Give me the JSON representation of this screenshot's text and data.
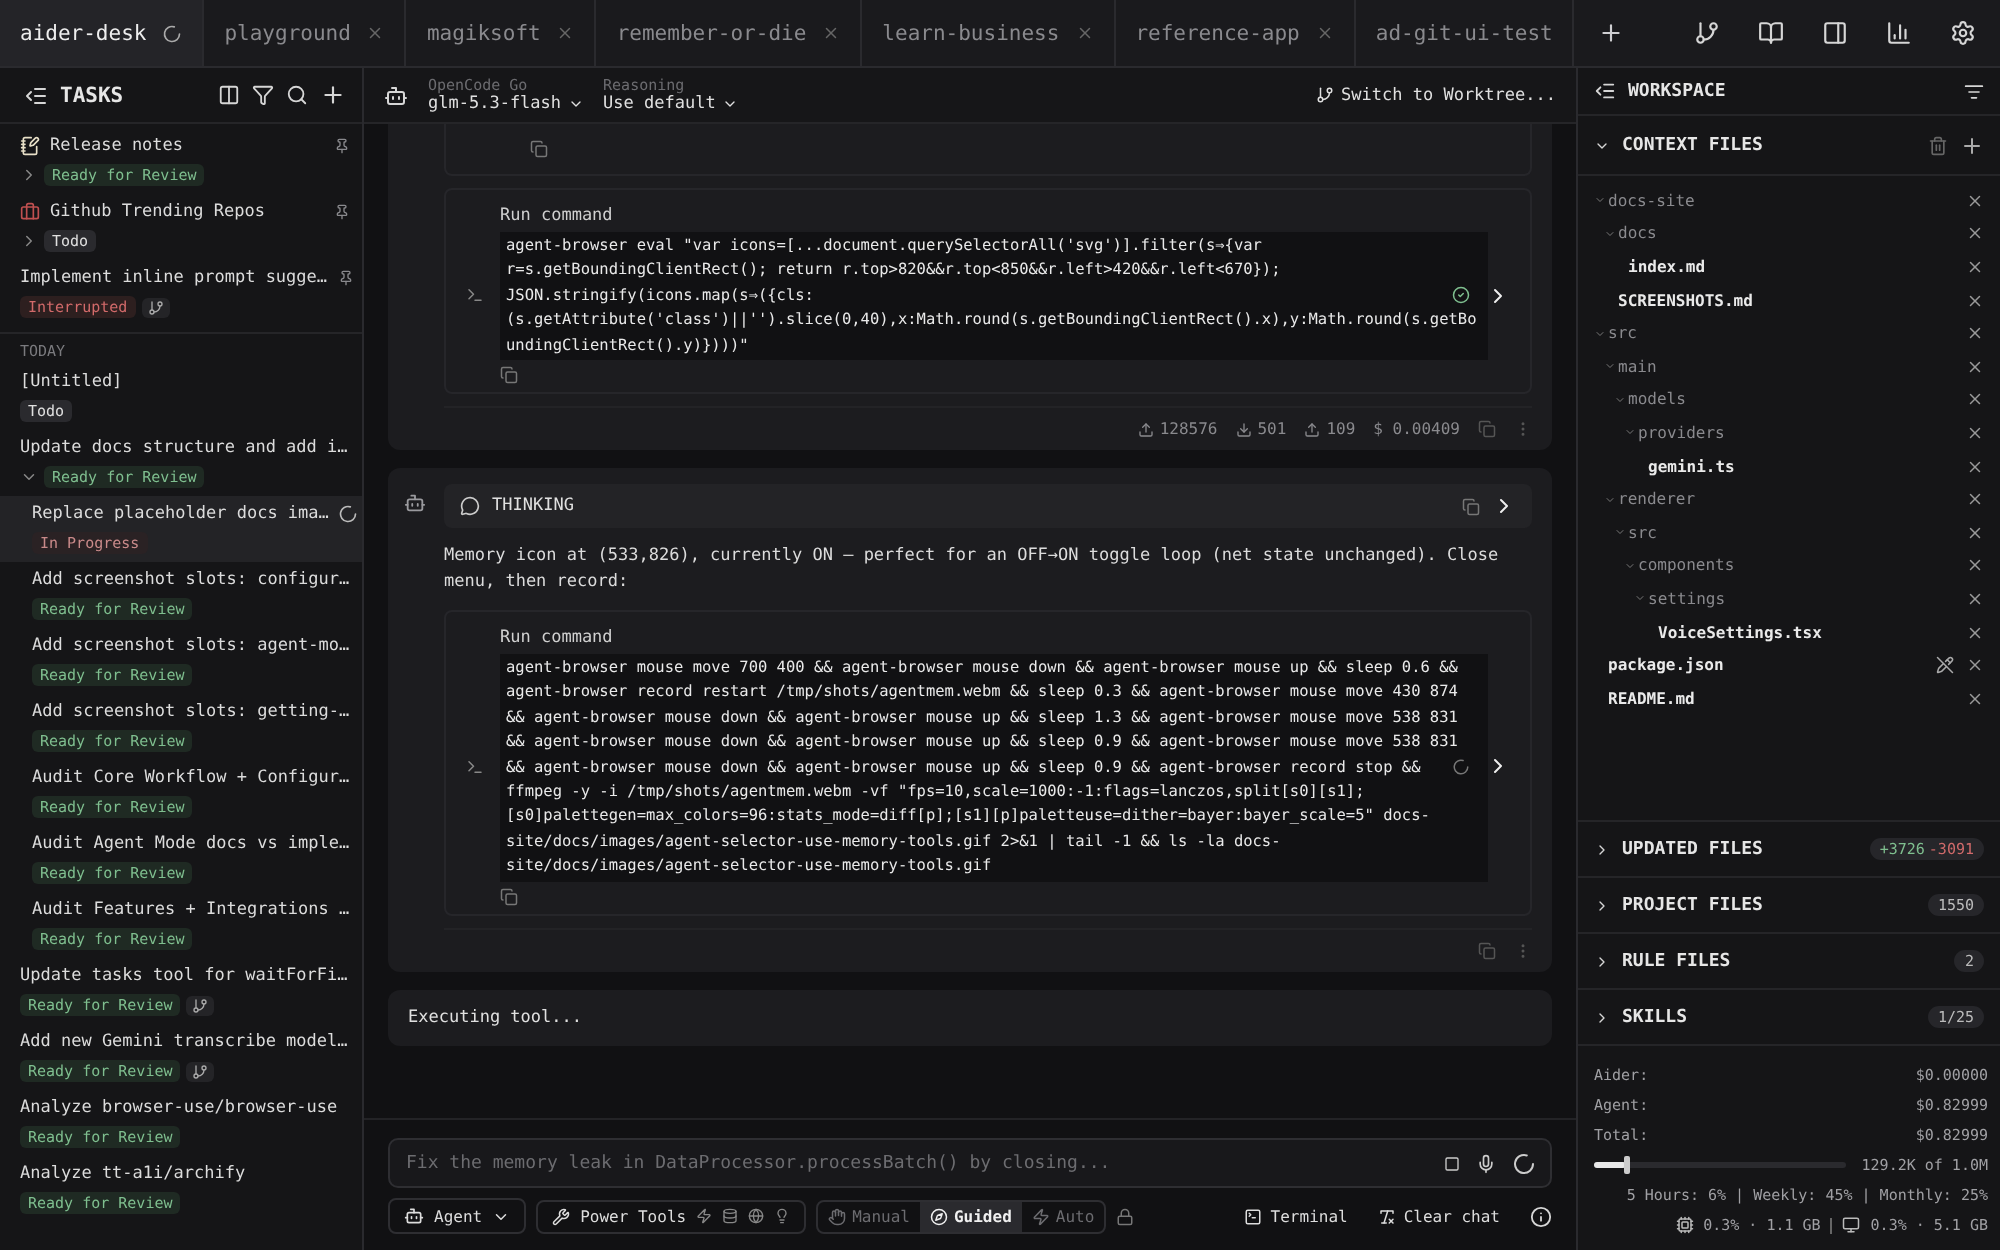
{
  "tabs": [
    {
      "label": "aider-desk",
      "selected": true,
      "loading": true,
      "closable": false
    },
    {
      "label": "playground",
      "selected": false,
      "loading": false,
      "closable": true
    },
    {
      "label": "magiksoft",
      "selected": false,
      "loading": false,
      "closable": true
    },
    {
      "label": "remember-or-die",
      "selected": false,
      "loading": false,
      "closable": true
    },
    {
      "label": "learn-business",
      "selected": false,
      "loading": false,
      "closable": true
    },
    {
      "label": "reference-app",
      "selected": false,
      "loading": false,
      "closable": true
    },
    {
      "label": "ad-git-ui-test",
      "selected": false,
      "loading": false,
      "closable": false
    }
  ],
  "tasks": {
    "title": "TASKS",
    "pinned": [
      {
        "title": "Release notes",
        "kind": "note",
        "pinned": true,
        "expanded": false,
        "status": {
          "label": "Ready for Review",
          "kind": "review"
        }
      },
      {
        "title": "Github Trending Repos",
        "kind": "briefcase",
        "pinned": true,
        "expanded": false,
        "status": {
          "label": "Todo",
          "kind": "todo"
        }
      },
      {
        "title": "Implement inline prompt sugge…",
        "pinned": true,
        "branch": true,
        "status": {
          "label": "Interrupted",
          "kind": "interrupted"
        }
      }
    ],
    "groups": [
      {
        "label": "TODAY",
        "items": [
          {
            "title": "[Untitled]",
            "status": {
              "label": "Todo",
              "kind": "todo"
            }
          },
          {
            "title": "Update docs structure and add i…",
            "expanded": true,
            "status": {
              "label": "Ready for Review",
              "kind": "review"
            },
            "children": [
              {
                "title": "Replace placeholder docs ima…",
                "selected": true,
                "loading": true,
                "status": {
                  "label": "In Progress",
                  "kind": "progress"
                }
              },
              {
                "title": "Add screenshot slots: configur…",
                "selected": false,
                "status": {
                  "label": "Ready for Review",
                  "kind": "review"
                }
              },
              {
                "title": "Add screenshot slots: agent-mo…",
                "selected": false,
                "status": {
                  "label": "Ready for Review",
                  "kind": "review"
                }
              },
              {
                "title": "Add screenshot slots: getting-…",
                "selected": false,
                "status": {
                  "label": "Ready for Review",
                  "kind": "review"
                }
              },
              {
                "title": "Audit Core Workflow + Configur…",
                "selected": false,
                "status": {
                  "label": "Ready for Review",
                  "kind": "review"
                }
              },
              {
                "title": "Audit Agent Mode docs vs imple…",
                "selected": false,
                "status": {
                  "label": "Ready for Review",
                  "kind": "review"
                }
              },
              {
                "title": "Audit Features + Integrations …",
                "selected": false,
                "status": {
                  "label": "Ready for Review",
                  "kind": "review"
                }
              }
            ]
          },
          {
            "title": "Update tasks tool for waitForFi…",
            "branch": true,
            "status": {
              "label": "Ready for Review",
              "kind": "review"
            }
          },
          {
            "title": "Add new Gemini transcribe model…",
            "branch": true,
            "status": {
              "label": "Ready for Review",
              "kind": "review"
            }
          },
          {
            "title": "Analyze browser-use/browser-use",
            "status": {
              "label": "Ready for Review",
              "kind": "review"
            }
          },
          {
            "title": "Analyze tt-a1i/archify",
            "status": {
              "label": "Ready for Review",
              "kind": "review"
            }
          }
        ]
      }
    ]
  },
  "model_bar": {
    "provider": "OpenCode Go",
    "model": "glm-5.3-flash",
    "reasoning_label": "Reasoning",
    "reasoning": "Use default",
    "worktree": "Switch to Worktree..."
  },
  "messages": [
    {
      "avatar": false,
      "blocks": [
        {
          "kind": "clipped_tool"
        },
        {
          "kind": "tool",
          "title": "Run command",
          "running": false,
          "command": "agent-browser eval \"var icons=[...document.querySelectorAll('svg')].filter(s⇒{var r=s.getBoundingClientRect(); return r.top>820&&r.top<850&&r.left>420&&r.left<670}); JSON.stringify(icons.map(s⇒({cls:(s.getAttribute('class')||'').slice(0,40),x:Math.round(s.getBoundingClientRect().x),y:Math.round(s.getBoundingClientRect().y)})))\""
        }
      ],
      "stats": [
        {
          "kind": "sent",
          "value": "128576"
        },
        {
          "kind": "received",
          "value": "501"
        },
        {
          "kind": "cache",
          "value": "109"
        },
        {
          "kind": "cost",
          "value": "$ 0.00409"
        }
      ]
    },
    {
      "avatar": true,
      "blocks": [
        {
          "kind": "thinking",
          "label": "THINKING"
        },
        {
          "kind": "text",
          "text": "Memory icon at (533,826), currently ON — perfect for an OFF→ON toggle loop (net state unchanged). Close menu, then record:"
        },
        {
          "kind": "tool",
          "title": "Run command",
          "running": true,
          "command": "agent-browser mouse move 700 400 && agent-browser mouse down && agent-browser mouse up && sleep 0.6 && agent-browser record restart /tmp/shots/agentmem.webm && sleep 0.3 && agent-browser mouse move 430 874 && agent-browser mouse down && agent-browser mouse up && sleep 1.3 && agent-browser mouse move 538 831 && agent-browser mouse down && agent-browser mouse up && sleep 0.9 && agent-browser mouse move 538 831 && agent-browser mouse down && agent-browser mouse up && sleep 0.9 && agent-browser record stop && ffmpeg -y -i /tmp/shots/agentmem.webm -vf \"fps=10,scale=1000:-1:flags=lanczos,split[s0][s1];[s0]palettegen=max_colors=96:stats_mode=diff[p];[s1][p]paletteuse=dither=bayer:bayer_scale=5\" docs-site/docs/images/agent-selector-use-memory-tools.gif 2>&1 | tail -1 && ls -la docs-site/docs/images/agent-selector-use-memory-tools.gif"
        }
      ]
    },
    {
      "kind": "status",
      "text": "Executing tool..."
    }
  ],
  "prompt": {
    "placeholder": "Fix the memory leak in DataProcessor.processBatch() by closing..."
  },
  "bottom_bar": {
    "agent": "Agent",
    "power_tools": "Power Tools",
    "modes": [
      {
        "label": "Manual",
        "kind": "manual",
        "selected": false
      },
      {
        "label": "Guided",
        "kind": "guided",
        "selected": true
      },
      {
        "label": "Auto",
        "kind": "auto",
        "selected": false
      }
    ],
    "terminal": "Terminal",
    "clear": "Clear chat"
  },
  "workspace": {
    "title": "WORKSPACE",
    "context_title": "CONTEXT FILES",
    "context_expanded": true,
    "tree": [
      {
        "name": "docs-site",
        "expanded": true,
        "children": [
          {
            "name": "docs",
            "expanded": true,
            "children": [
              {
                "name": "index.md"
              }
            ]
          },
          {
            "name": "SCREENSHOTS.md"
          }
        ]
      },
      {
        "name": "src",
        "expanded": true,
        "children": [
          {
            "name": "main",
            "expanded": true,
            "children": [
              {
                "name": "models",
                "expanded": true,
                "children": [
                  {
                    "name": "providers",
                    "expanded": true,
                    "children": [
                      {
                        "name": "gemini.ts"
                      }
                    ]
                  }
                ]
              }
            ]
          },
          {
            "name": "renderer",
            "expanded": true,
            "children": [
              {
                "name": "src",
                "expanded": true,
                "children": [
                  {
                    "name": "components",
                    "expanded": true,
                    "children": [
                      {
                        "name": "settings",
                        "expanded": true,
                        "children": [
                          {
                            "name": "VoiceSettings.tsx"
                          }
                        ]
                      }
                    ]
                  }
                ]
              }
            ]
          }
        ]
      },
      {
        "name": "package.json",
        "hovered": true
      },
      {
        "name": "README.md"
      }
    ],
    "sections": [
      {
        "title": "UPDATED FILES",
        "expanded": false,
        "additions": "+3726",
        "deletions": "-3091"
      },
      {
        "title": "PROJECT FILES",
        "expanded": false,
        "count": "1550"
      },
      {
        "title": "RULE FILES",
        "expanded": false,
        "count": "2"
      },
      {
        "title": "SKILLS",
        "expanded": false,
        "count": "1/25"
      }
    ],
    "costs": [
      {
        "label": "Aider:",
        "value": "$0.00000"
      },
      {
        "label": "Agent:",
        "value": "$0.82999"
      },
      {
        "label": "Total:",
        "value": "$0.82999"
      }
    ],
    "tokens": {
      "level": 0.13,
      "reading": "129.2K of 1.0M"
    },
    "usage": "5 Hours: 6% | Weekly: 45% | Monthly: 25%",
    "system": [
      {
        "kind": "cpu",
        "text": "0.3% · 1.1 GB"
      },
      {
        "kind": "monitor",
        "text": "0.3% · 5.1 GB"
      }
    ]
  }
}
